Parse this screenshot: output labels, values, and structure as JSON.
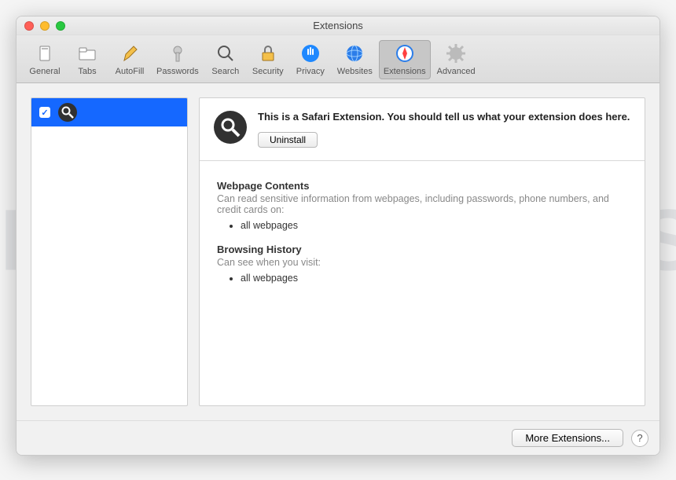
{
  "window": {
    "title": "Extensions"
  },
  "toolbar": {
    "items": [
      {
        "label": "General",
        "icon": "general"
      },
      {
        "label": "Tabs",
        "icon": "tabs"
      },
      {
        "label": "AutoFill",
        "icon": "autofill"
      },
      {
        "label": "Passwords",
        "icon": "passwords"
      },
      {
        "label": "Search",
        "icon": "search"
      },
      {
        "label": "Security",
        "icon": "security"
      },
      {
        "label": "Privacy",
        "icon": "privacy"
      },
      {
        "label": "Websites",
        "icon": "websites"
      },
      {
        "label": "Extensions",
        "icon": "extensions",
        "selected": true
      },
      {
        "label": "Advanced",
        "icon": "advanced"
      }
    ]
  },
  "sidebar": {
    "items": [
      {
        "checked": true,
        "name": ""
      }
    ]
  },
  "detail": {
    "description": "This is a Safari Extension. You should tell us what your extension does here.",
    "uninstall_label": "Uninstall",
    "sections": [
      {
        "title": "Webpage Contents",
        "desc": "Can read sensitive information from webpages, including passwords, phone numbers, and credit cards on:",
        "bullets": [
          "all webpages"
        ]
      },
      {
        "title": "Browsing History",
        "desc": "Can see when you visit:",
        "bullets": [
          "all webpages"
        ]
      }
    ]
  },
  "footer": {
    "more_label": "More Extensions...",
    "help_label": "?"
  },
  "watermark": "MALWARETIPS"
}
